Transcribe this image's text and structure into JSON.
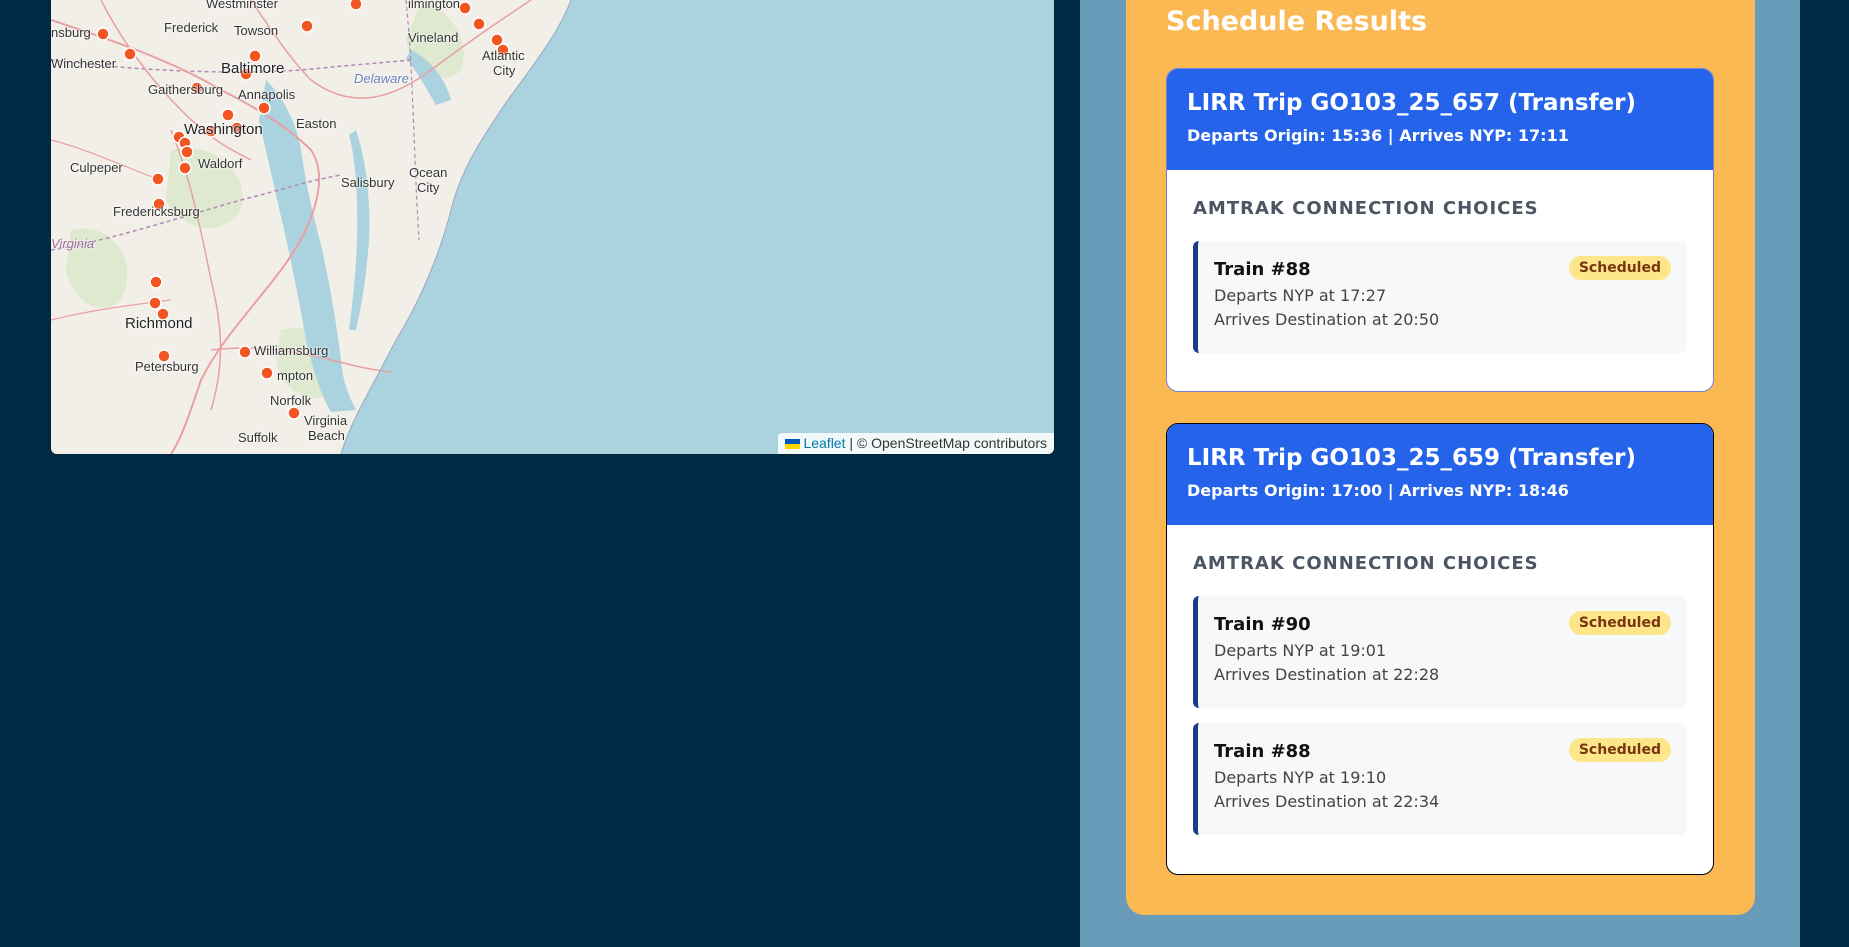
{
  "map": {
    "labels": {
      "frederick": "Frederick",
      "westminster": "Westminster",
      "towson": "Towson",
      "vineland": "Vineland",
      "atlantic_city_1": "Atlantic",
      "atlantic_city_2": "City",
      "winchester": "Winchester",
      "nsburg": "nsburg",
      "baltimore": "Baltimore",
      "gaithersburg": "Gaithersburg",
      "annapolis": "Annapolis",
      "delaware": "Delaware",
      "washington": "Washington",
      "easton": "Easton",
      "culpeper": "Culpeper",
      "waldorf": "Waldorf",
      "salisbury": "Salisbury",
      "ocean_city_1": "Ocean",
      "ocean_city_2": "City",
      "fredericksburg": "Fredericksburg",
      "virginia": "Virginia",
      "richmond": "Richmond",
      "williamsburg": "Williamsburg",
      "petersburg": "Petersburg",
      "hampton": "mpton",
      "norfolk": "Norfolk",
      "virginia_beach_1": "Virginia",
      "virginia_beach_2": "Beach",
      "suffolk": "Suffolk",
      "ilmington": "ilmington"
    },
    "attribution": {
      "leaflet": "Leaflet",
      "separator": "|",
      "copyright": "© OpenStreetMap contributors"
    },
    "marker_color": "#f25522"
  },
  "results": {
    "title": "Schedule Results",
    "trips": [
      {
        "title": "LIRR Trip GO103_25_657 (Transfer)",
        "times": "Departs Origin: 15:36 | Arrives NYP: 17:11",
        "section_label": "AMTRAK CONNECTION CHOICES",
        "connections": [
          {
            "train": "Train #88",
            "status": "Scheduled",
            "departs": "Departs NYP at 17:27",
            "arrives": "Arrives Destination at 20:50"
          }
        ]
      },
      {
        "title": "LIRR Trip GO103_25_659 (Transfer)",
        "times": "Departs Origin: 17:00 | Arrives NYP: 18:46",
        "section_label": "AMTRAK CONNECTION CHOICES",
        "connections": [
          {
            "train": "Train #90",
            "status": "Scheduled",
            "departs": "Departs NYP at 19:01",
            "arrives": "Arrives Destination at 22:28"
          },
          {
            "train": "Train #88",
            "status": "Scheduled",
            "departs": "Departs NYP at 19:10",
            "arrives": "Arrives Destination at 22:34"
          }
        ]
      }
    ]
  },
  "colors": {
    "page_background": "#002b45",
    "outer_panel": "#679bb8",
    "results_panel": "#fbb954",
    "card_header": "#2563eb",
    "badge": "#fde68a"
  }
}
